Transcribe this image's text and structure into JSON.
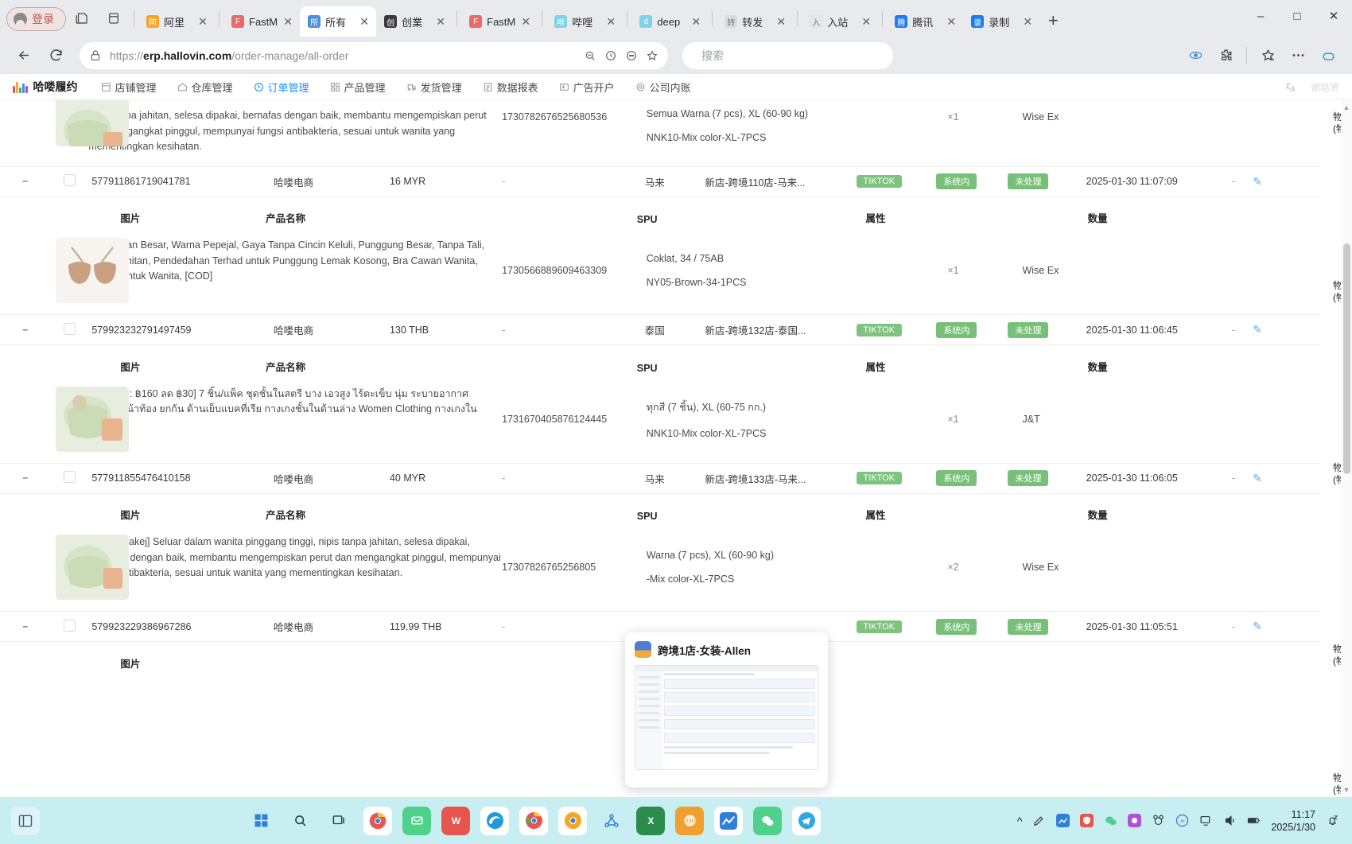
{
  "browser": {
    "profile_label": "登录",
    "tabs": [
      {
        "title": "阿里",
        "fav": "阿",
        "fav_color": "#f5a623",
        "active": false
      },
      {
        "title": "FastM",
        "fav": "F",
        "fav_color": "#e86a6a",
        "active": false
      },
      {
        "title": "所有",
        "fav": "所",
        "fav_color": "#4a90d9",
        "active": true
      },
      {
        "title": "创業",
        "fav": "创",
        "fav_color": "#3a3a3a",
        "active": false
      },
      {
        "title": "FastM",
        "fav": "F",
        "fav_color": "#e86a6a",
        "active": false
      },
      {
        "title": "哔哩",
        "fav": "哔",
        "fav_color": "#7fd3e8",
        "active": false
      },
      {
        "title": "deep",
        "fav": "d",
        "fav_color": "#7fd3e8",
        "active": false
      },
      {
        "title": "转发",
        "fav": "转",
        "fav_color": "#bfbfbf",
        "active": false
      },
      {
        "title": "入站",
        "fav": "入",
        "fav_color": "#cfcfcf",
        "active": false
      },
      {
        "title": "腾讯",
        "fav": "腾",
        "fav_color": "#1f7cf0",
        "active": false
      },
      {
        "title": "录制",
        "fav": "录",
        "fav_color": "#1f7cf0",
        "active": false
      }
    ],
    "new_tab_label": "+",
    "window_buttons": [
      "–",
      "□",
      "✕"
    ],
    "url_prefix": "https://",
    "url_domain": "erp.hallovin.com",
    "url_path": "/order-manage/all-order",
    "search_placeholder": "搜索"
  },
  "erp_nav": {
    "logo_text": "哈喽履约",
    "logo_colors": [
      "#e8554f",
      "#f2a93b",
      "#3bb273",
      "#4a90d9",
      "#9b59b6"
    ],
    "items": [
      {
        "label": "店铺管理",
        "icon": "shop-icon",
        "active": false
      },
      {
        "label": "仓库管理",
        "icon": "warehouse-icon",
        "active": false
      },
      {
        "label": "订单管理",
        "icon": "order-icon",
        "active": true
      },
      {
        "label": "产品管理",
        "icon": "product-icon",
        "active": false
      },
      {
        "label": "发货管理",
        "icon": "shipping-icon",
        "active": false
      },
      {
        "label": "数据报表",
        "icon": "report-icon",
        "active": false
      },
      {
        "label": "广告开户",
        "icon": "ad-icon",
        "active": false
      },
      {
        "label": "公司内账",
        "icon": "account-icon",
        "active": false
      }
    ],
    "translate_icon": "translate-icon",
    "user_name": "谢培贤"
  },
  "table": {
    "sub_headers": [
      "图片",
      "产品名称",
      "SPU",
      "属性",
      "数量"
    ],
    "truncated_header_line1": "物",
    "truncated_header_line2": "(物",
    "quantity_prefix": "×",
    "orders": [
      {
        "partial_top": true,
        "product": {
          "description": "nipis tanpa jahitan, selesa dipakai, bernafas dengan baik, membantu mengempiskan perut dan mengangkat pinggul, mempunyai fungsi antibakteria, sesuai untuk wanita yang mementingkan kesihatan.",
          "spu": "1730782676525680536",
          "attr_line1": "Semua Warna (7 pcs), XL (60-90 kg)",
          "attr_line2": "NNK10-Mix color-XL-7PCS",
          "qty": "×1",
          "carrier": "Wise Ex",
          "image": "underwear"
        },
        "order_id": "577911861719041781",
        "shop": "哈喽电商",
        "amount": "16 MYR",
        "dash": "-",
        "country": "马来",
        "store": "新店-跨境110店-马来...",
        "tags": [
          "TIKTOK",
          "系统内",
          "未处理"
        ],
        "time": "2025-01-30 11:07:09",
        "edit_dash": "-"
      },
      {
        "product": {
          "description": "Bra Cawan Besar, Warna Pepejal, Gaya Tanpa Cincin Keluli, Punggung Besar, Tanpa Tali, Tiada Jahitan, Pendedahan Terhad untuk Punggung Lemak Kosong, Bra Cawan Wanita, Sesuai untuk Wanita, [COD]",
          "spu": "1730566889609463309",
          "attr_line1": "Coklat, 34 / 75AB",
          "attr_line2": "NY05-Brown-34-1PCS",
          "qty": "×1",
          "carrier": "Wise Ex",
          "image": "bra"
        },
        "order_id": "579923232791497459",
        "shop": "哈喽电商",
        "amount": "130 THB",
        "dash": "-",
        "country": "泰国",
        "store": "新店-跨境132店-泰国...",
        "tags": [
          "TIKTOK",
          "系统内",
          "未处理"
        ],
        "time": "2025-01-30 11:06:45",
        "edit_dash": "-"
      },
      {
        "product": {
          "description": "[ รับคูปอง: ฿160 ลด ฿30] 7 ชิ้น/แพ็ค ชุดชั้นในสตรี บาง เอวสูง ไร้ตะเข็บ นุ่ม ระบายอากาศ ควบคุมหน้าท้อง ยกก้น ด้านเย็บแบคที่เรีย กางเกงชั้นในด้านล่าง Women Clothing กางเกงใน เสื้อผ้า",
          "spu": "1731670405876124445",
          "attr_line1": "ทุกสี (7 ชิ้น), XL (60-75 กก.)",
          "attr_line2": "NNK10-Mix color-XL-7PCS",
          "qty": "×1",
          "carrier": "J&T",
          "image": "underwear"
        },
        "order_id": "577911855476410158",
        "shop": "哈喽电商",
        "amount": "40 MYR",
        "dash": "-",
        "country": "马来",
        "store": "新店-跨境133店-马来...",
        "tags": [
          "TIKTOK",
          "系统内",
          "未处理"
        ],
        "time": "2025-01-30 11:06:05",
        "edit_dash": "-"
      },
      {
        "product": {
          "description": "[7 helai/pakej] Seluar dalam wanita pinggang tinggi, nipis tanpa jahitan, selesa dipakai, bernafas dengan baik, membantu mengempiskan perut dan mengangkat pinggul, mempunyai fungsi antibakteria, sesuai untuk wanita yang mementingkan kesihatan.",
          "spu": "17307826765256805",
          "attr_line1": "Warna (7 pcs), XL (60-90 kg)",
          "attr_line2": "-Mix color-XL-7PCS",
          "qty": "×2",
          "carrier": "Wise Ex",
          "image": "underwear"
        },
        "order_id": "579923229386967286",
        "shop": "哈喽电商",
        "amount": "119.99 THB",
        "dash": "-",
        "country": "",
        "store": "",
        "tags": [
          "TIKTOK",
          "系统内",
          "未处理"
        ],
        "time": "2025-01-30 11:05:51",
        "edit_dash": "-"
      }
    ]
  },
  "toast": {
    "title": "跨境1店-女装-Allen",
    "avatar_icon": "app-avatar-icon"
  },
  "taskbar": {
    "start_icon": "start-icon",
    "search_icon": "taskbar-search-icon",
    "taskview_icon": "task-view-icon",
    "apps": [
      {
        "name": "chrome-icon",
        "color": "#e8554f"
      },
      {
        "name": "mail-icon",
        "color": "#4fd18b"
      },
      {
        "name": "wps-icon",
        "color": "#e8554f"
      },
      {
        "name": "edge-icon",
        "color": "#1f9bdc"
      },
      {
        "name": "chrome2-icon",
        "color": "#e8554f"
      },
      {
        "name": "chrome3-icon",
        "color": "#f5a623"
      },
      {
        "name": "network-icon",
        "color": "#4a90d9"
      },
      {
        "name": "excel-icon",
        "color": "#2b8c4e"
      },
      {
        "name": "erp-icon",
        "color": "#f0a030"
      },
      {
        "name": "analytics-icon",
        "color": "#4a90d9"
      },
      {
        "name": "wechat-icon",
        "color": "#4fd18b"
      },
      {
        "name": "telegram-icon",
        "color": "#2fa8e0"
      }
    ],
    "tray": [
      {
        "name": "chevron-up-icon"
      },
      {
        "name": "pen-icon"
      },
      {
        "name": "tray-app-icon"
      },
      {
        "name": "shield-icon"
      },
      {
        "name": "wechat-tray-icon"
      },
      {
        "name": "purple-tray-icon"
      },
      {
        "name": "bear-tray-icon"
      },
      {
        "name": "blue-tray-icon"
      },
      {
        "name": "monitor-icon"
      },
      {
        "name": "volume-icon"
      },
      {
        "name": "battery-icon"
      }
    ],
    "time": "11:17",
    "date": "2025/1/30",
    "notification_icon": "bell-dnd-icon"
  }
}
